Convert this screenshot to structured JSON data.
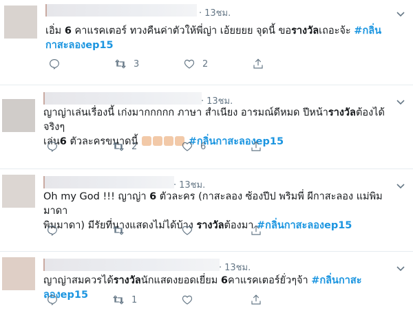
{
  "tweets": [
    {
      "time": "13ชม.",
      "line1": [
        "เอิ่ม ",
        "6",
        " คาแรคเตอร์  ทวงคืนค่าตัวให้พี่ญ่า  เอ้ยยยย  จุดนี้ ขอ",
        "รางวัล",
        "เถอะจ้ะ ",
        "#กลิ่น"
      ],
      "line2": [
        "กาสะลองep15"
      ],
      "retweets": "3",
      "likes": "2"
    },
    {
      "time": "13ชม.",
      "line1": [
        "ญาญ่าเล่นเรื่องนี้ เก่งมากกกกก ภาษา สำเนียง อารมณ์ดีหมด ปีหน้า",
        "รางวัล",
        "ต้องได้จริงๆ"
      ],
      "line2": [
        "เล่น",
        "6",
        " ตัวละครขนาดนี้ ",
        "",
        " ",
        "#กลิ่นกาสะลองep15"
      ],
      "retweets": "2",
      "likes": "6"
    },
    {
      "time": "13ชม.",
      "line1": [
        "Oh my God !!! ญาญ่า ",
        "6",
        " ตัวละคร (กาสะลอง ซ้องปีป พริมพี่ ผีกาสะลอง แม่พิมมาดา"
      ],
      "line2": [
        "พิมมาดา) มีรัยที่นางแสดงไม่ได้บ้าง ",
        "รางวัล",
        "ต้องมา ",
        "#กลิ่นกาสะลองep15"
      ],
      "retweets": "",
      "likes": ""
    },
    {
      "time": "13ชม.",
      "line1": [
        "ญาญ่าสมควรได้",
        "รางวัล",
        "นักแสดงยอดเยี่ยม ",
        "6",
        "คาแรคเตอร์ยั่วๆจ้า ",
        "#กลิ่นกาสะลองep15"
      ],
      "retweets": "1",
      "likes": ""
    }
  ],
  "icons": {
    "reply": "reply-icon",
    "retweet": "retweet-icon",
    "like": "heart-icon",
    "share": "share-icon",
    "caret": "chevron-down-icon"
  }
}
